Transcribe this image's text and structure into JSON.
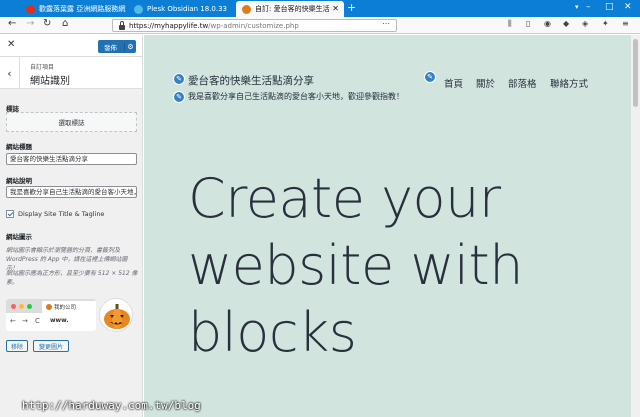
{
  "browser": {
    "tabs": [
      {
        "title": "歡露落葉露 亞洲網路服務網站...",
        "icon_color": "#d93025"
      },
      {
        "title": "Plesk Obsidian 18.0.33",
        "icon_color": "#52bbe6"
      },
      {
        "title": "自訂: 愛台客的快樂生活點滴分享",
        "icon_color": "#e07b1b"
      }
    ],
    "new_tab": "+",
    "url_domain": "https://myhappylife.tw",
    "url_path": "/wp-admin/customize.php"
  },
  "customizer": {
    "close": "✕",
    "publish_label": "發佈",
    "breadcrumb": "自訂項目",
    "section_title": "網站識別",
    "logo_label": "標誌",
    "logo_button": "選取標誌",
    "site_title_label": "網站標題",
    "site_title_value": "愛台客的快樂生活點滴分享",
    "tagline_label": "網站說明",
    "tagline_value": "我是喜歡分享自己生活點滴的愛台客小天地，歡迎參觀指教！",
    "display_toggle": "Display Site Title & Tagline",
    "site_icon_label": "網站圖示",
    "site_icon_desc1": "網站圖示會顯示於瀏覽器的分頁、書籤列及 WordPress 的 App 中，請在這裡上傳網站圖示！",
    "site_icon_desc2": "網站圖示應為正方形，且至少要有 512 × 512 像素。",
    "preview_tab_title": "我的公司",
    "preview_url": "www.",
    "remove_button": "移除",
    "change_button": "變更圖片"
  },
  "site": {
    "title": "愛台客的快樂生活點滴分享",
    "tagline": "我是喜歡分享自己生活點滴的愛台客小天地，歡迎參觀指教！",
    "menu": [
      "首頁",
      "關於",
      "部落格",
      "聯絡方式"
    ],
    "hero_lines": [
      "Create your",
      "website with",
      "blocks"
    ]
  },
  "watermark": "http://harduway.com.tw/blog",
  "colors": {
    "accent": "#2271b1",
    "preview_bg": "#d1e4dd",
    "tabbar": "#0c7ed6"
  }
}
